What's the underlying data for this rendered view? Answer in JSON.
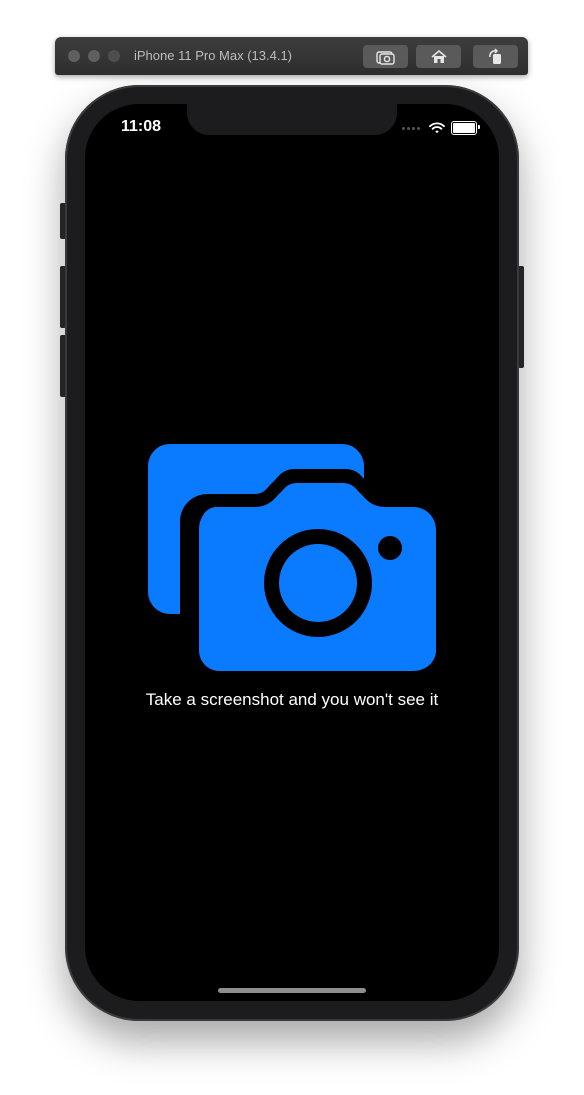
{
  "window": {
    "title": "iPhone 11 Pro Max (13.4.1)",
    "toolbar": [
      "screenshot-icon",
      "home-icon",
      "rotate-icon"
    ]
  },
  "status_bar": {
    "time": "11:08",
    "icons": [
      "signal-dots-icon",
      "wifi-icon",
      "battery-icon"
    ]
  },
  "main": {
    "icon": "camera-on-camera-icon",
    "accent_color": "#0a7aff",
    "caption": "Take a screenshot and you won't see it"
  }
}
